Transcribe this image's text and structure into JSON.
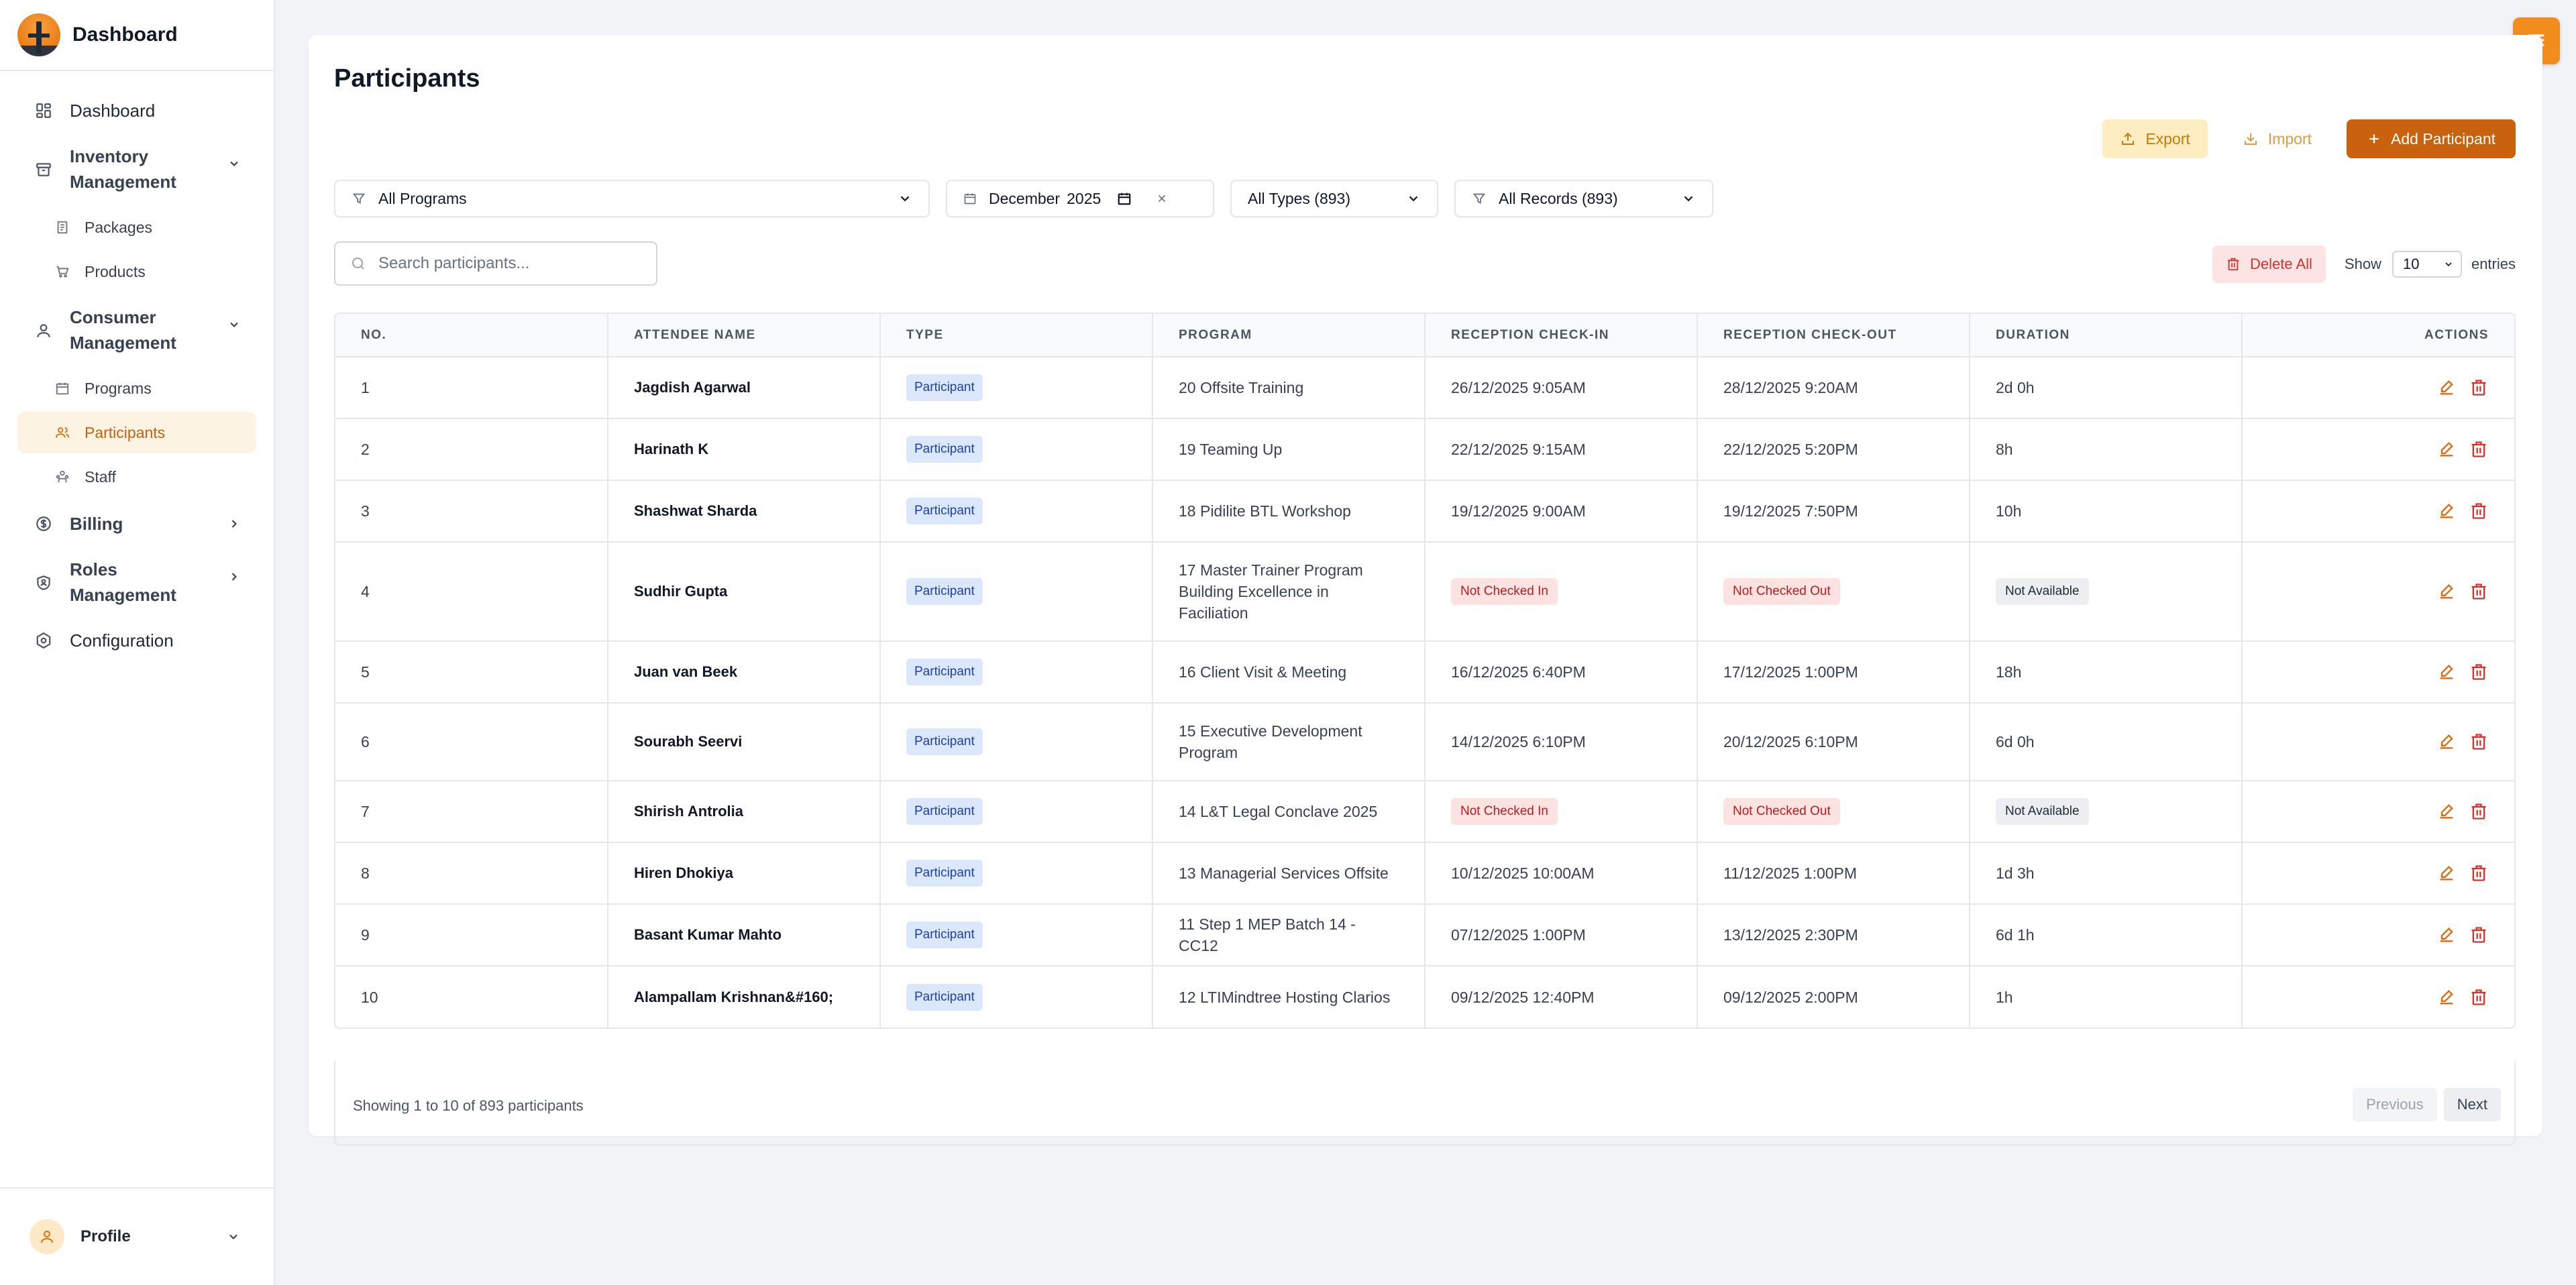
{
  "brand": {
    "title": "Dashboard"
  },
  "sidebar": {
    "dashboard": "Dashboard",
    "inventory": {
      "label": "Inventory Management",
      "items": [
        "Packages",
        "Products"
      ]
    },
    "consumer": {
      "label": "Consumer Management",
      "items": [
        "Programs",
        "Participants",
        "Staff"
      ]
    },
    "billing": "Billing",
    "roles": "Roles Management",
    "configuration": "Configuration",
    "profile": "Profile"
  },
  "page": {
    "title": "Participants"
  },
  "actions": {
    "export": "Export",
    "import": "Import",
    "add": "Add Participant"
  },
  "filters": {
    "programs": "All Programs",
    "date_month": "December",
    "date_year": "2025",
    "types": "All Types (893)",
    "records": "All Records (893)"
  },
  "search": {
    "placeholder": "Search participants..."
  },
  "tools": {
    "delete_all": "Delete All",
    "show": "Show",
    "entries_value": "10",
    "entries": "entries"
  },
  "table": {
    "headers": [
      "NO.",
      "ATTENDEE NAME",
      "TYPE",
      "PROGRAM",
      "RECEPTION CHECK-IN",
      "RECEPTION CHECK-OUT",
      "DURATION",
      "ACTIONS"
    ],
    "rows": [
      {
        "no": "1",
        "name": "Jagdish Agarwal",
        "type": "Participant",
        "program": "20 Offsite Training",
        "checkin": "26/12/2025 9:05AM",
        "checkout": "28/12/2025 9:20AM",
        "duration": "2d 0h"
      },
      {
        "no": "2",
        "name": "Harinath K",
        "type": "Participant",
        "program": "19 Teaming Up",
        "checkin": "22/12/2025 9:15AM",
        "checkout": "22/12/2025 5:20PM",
        "duration": "8h"
      },
      {
        "no": "3",
        "name": "Shashwat Sharda",
        "type": "Participant",
        "program": "18 Pidilite BTL Workshop",
        "checkin": "19/12/2025 9:00AM",
        "checkout": "19/12/2025 7:50PM",
        "duration": "10h"
      },
      {
        "no": "4",
        "name": "Sudhir Gupta",
        "type": "Participant",
        "program": "17 Master Trainer Program Building Excellence in Faciliation",
        "checkin": "Not Checked In",
        "checkout": "Not Checked Out",
        "duration": "Not Available"
      },
      {
        "no": "5",
        "name": "Juan van Beek",
        "type": "Participant",
        "program": "16 Client Visit & Meeting",
        "checkin": "16/12/2025 6:40PM",
        "checkout": "17/12/2025 1:00PM",
        "duration": "18h"
      },
      {
        "no": "6",
        "name": "Sourabh Seervi",
        "type": "Participant",
        "program": "15 Executive Development Program",
        "checkin": "14/12/2025 6:10PM",
        "checkout": "20/12/2025 6:10PM",
        "duration": "6d 0h"
      },
      {
        "no": "7",
        "name": "Shirish Antrolia",
        "type": "Participant",
        "program": "14 L&T Legal Conclave 2025",
        "checkin": "Not Checked In",
        "checkout": "Not Checked Out",
        "duration": "Not Available"
      },
      {
        "no": "8",
        "name": "Hiren Dhokiya",
        "type": "Participant",
        "program": "13 Managerial Services Offsite",
        "checkin": "10/12/2025 10:00AM",
        "checkout": "11/12/2025 1:00PM",
        "duration": "1d 3h"
      },
      {
        "no": "9",
        "name": "Basant Kumar Mahto",
        "type": "Participant",
        "program": "11 Step 1 MEP Batch 14 - CC12",
        "checkin": "07/12/2025 1:00PM",
        "checkout": "13/12/2025 2:30PM",
        "duration": "6d 1h"
      },
      {
        "no": "10",
        "name": "Alampallam Krishnan&#160;",
        "type": "Participant",
        "program": "12 LTIMindtree Hosting Clarios",
        "checkin": "09/12/2025 12:40PM",
        "checkout": "09/12/2025 2:00PM",
        "duration": "1h"
      }
    ]
  },
  "footer": {
    "showing": "Showing 1 to 10 of 893 participants",
    "previous": "Previous",
    "next": "Next"
  },
  "colors": {
    "accent": "#c8620e",
    "accent_light": "#fdf3e3",
    "danger": "#d0342c",
    "badge_blue": "#dbe7fb"
  }
}
